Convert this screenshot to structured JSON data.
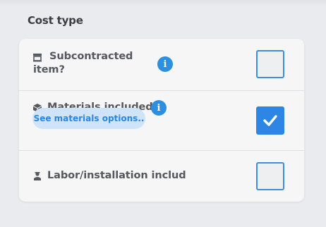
{
  "section": {
    "title": "Cost type"
  },
  "rows": [
    {
      "label_line1": "Subcontracted",
      "label_line2": "item?",
      "icon": "store-icon",
      "info_icon": "info-icon",
      "checked": false
    },
    {
      "label": "Materials included?",
      "icon": "boxes-icon",
      "info_icon": "info-icon",
      "checked": true,
      "button_label": "See materials options.."
    },
    {
      "label": "Labor/installation includ",
      "icon": "worker-icon",
      "checked": false
    }
  ],
  "colors": {
    "accent": "#2d86e3",
    "button_bg": "#cfe4f8",
    "text": "#55585e"
  }
}
